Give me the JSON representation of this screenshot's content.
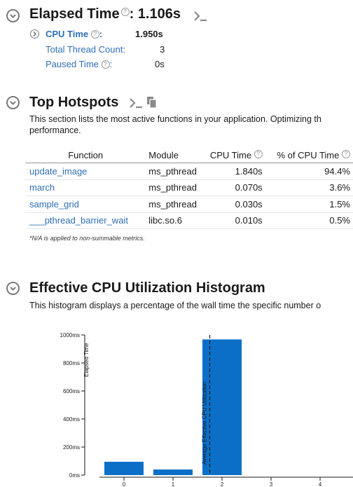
{
  "elapsed": {
    "title": "Elapsed Time",
    "help": "?",
    "value": ": 1.106s",
    "cpu_time_label": "CPU Time",
    "cpu_time_suffix": ":",
    "cpu_time_value": "1.950s",
    "thread_count_label": "Total Thread Count:",
    "thread_count_value": "3",
    "paused_label": "Paused Time",
    "paused_suffix": ":",
    "paused_value": "0s"
  },
  "hotspots": {
    "title": "Top Hotspots",
    "description_line1": "This section lists the most active functions in your application. Optimizing th",
    "description_line2": "performance.",
    "columns": [
      "Function",
      "Module",
      "CPU Time",
      "% of CPU Time"
    ],
    "rows": [
      {
        "function": "update_image",
        "module": "ms_pthread",
        "cpu_time": "1.840s",
        "percent": "94.4%"
      },
      {
        "function": "march",
        "module": "ms_pthread",
        "cpu_time": "0.070s",
        "percent": "3.6%"
      },
      {
        "function": "sample_grid",
        "module": "ms_pthread",
        "cpu_time": "0.030s",
        "percent": "1.5%"
      },
      {
        "function": "___pthread_barrier_wait",
        "module": "libc.so.6",
        "cpu_time": "0.010s",
        "percent": "0.5%"
      }
    ],
    "note": "*N/A is applied to non-summable metrics."
  },
  "histogram": {
    "title": "Effective CPU Utilization Histogram",
    "description": "This histogram displays a percentage of the wall time the specific number o"
  },
  "colors": {
    "link": "#2f6fb3",
    "bar": "#0b6fc8",
    "icon_gray": "#7a7a7a"
  },
  "chart_data": {
    "type": "bar",
    "categories": [
      "0",
      "1",
      "2",
      "3",
      "4"
    ],
    "values": [
      95,
      40,
      968,
      0,
      0
    ],
    "ylabel": "Elapsed Time",
    "ylim": [
      0,
      1000
    ],
    "y_ticks": [
      "0ms",
      "200ms",
      "400ms",
      "600ms",
      "800ms",
      "1000ms"
    ],
    "average_marker": {
      "x": 1.75,
      "label": "Average Effective CPU Utilization"
    },
    "grid": false
  }
}
